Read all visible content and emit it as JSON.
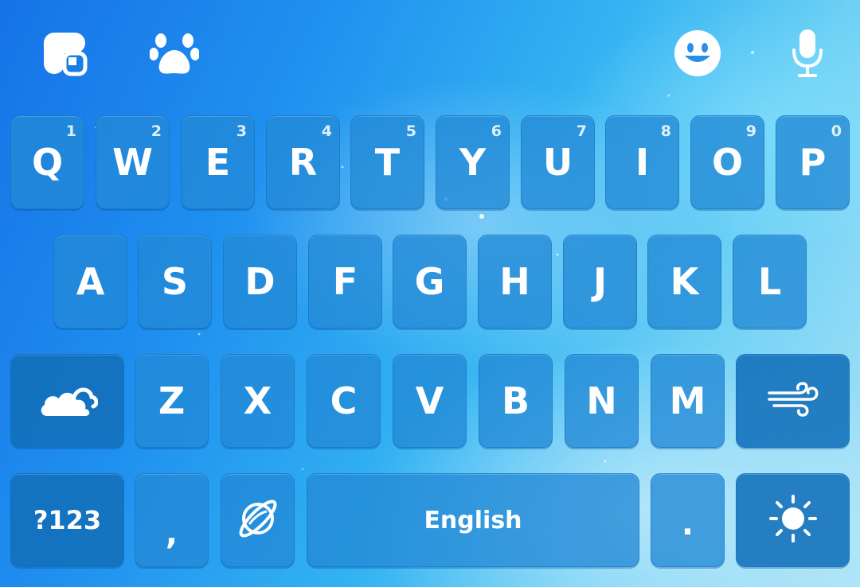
{
  "toolbar": {
    "left": [
      "clover-app-icon",
      "paw-icon"
    ],
    "right": [
      "emoji-icon",
      "microphone-icon"
    ]
  },
  "rows": [
    [
      {
        "label": "Q",
        "hint": "1"
      },
      {
        "label": "W",
        "hint": "2"
      },
      {
        "label": "E",
        "hint": "3"
      },
      {
        "label": "R",
        "hint": "4"
      },
      {
        "label": "T",
        "hint": "5"
      },
      {
        "label": "Y",
        "hint": "6"
      },
      {
        "label": "U",
        "hint": "7"
      },
      {
        "label": "I",
        "hint": "8"
      },
      {
        "label": "O",
        "hint": "9"
      },
      {
        "label": "P",
        "hint": "0"
      }
    ],
    [
      {
        "label": "A"
      },
      {
        "label": "S"
      },
      {
        "label": "D"
      },
      {
        "label": "F"
      },
      {
        "label": "G"
      },
      {
        "label": "H"
      },
      {
        "label": "J"
      },
      {
        "label": "K"
      },
      {
        "label": "L"
      }
    ],
    [
      {
        "label": "Z"
      },
      {
        "label": "X"
      },
      {
        "label": "C"
      },
      {
        "label": "V"
      },
      {
        "label": "B"
      },
      {
        "label": "N"
      },
      {
        "label": "M"
      }
    ]
  ],
  "special_keys": {
    "shift_icon": "clouds-icon",
    "backspace_icon": "wind-icon",
    "symbols_label": "?123",
    "comma_label": ",",
    "language_icon": "planet-icon",
    "space_label": "English",
    "period_label": ".",
    "enter_icon": "sun-icon"
  }
}
